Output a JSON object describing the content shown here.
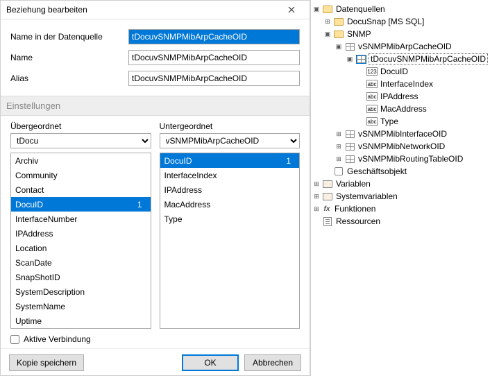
{
  "dialog": {
    "title": "Beziehung bearbeiten",
    "fields": {
      "datasourceLabel": "Name in der Datenquelle",
      "datasourceValue": "tDocuvSNMPMibArpCacheOID",
      "nameLabel": "Name",
      "nameValue": "tDocuvSNMPMibArpCacheOID",
      "aliasLabel": "Alias",
      "aliasValue": "tDocuvSNMPMibArpCacheOID"
    },
    "settingsHeader": "Einstellungen",
    "parent": {
      "label": "Übergeordnet",
      "selected": "tDocu",
      "items": [
        {
          "text": "Archiv"
        },
        {
          "text": "Community"
        },
        {
          "text": "Contact"
        },
        {
          "text": "DocuID",
          "num": "1",
          "selected": true
        },
        {
          "text": "InterfaceNumber"
        },
        {
          "text": "IPAddress"
        },
        {
          "text": "Location"
        },
        {
          "text": "ScanDate"
        },
        {
          "text": "SnapShotID"
        },
        {
          "text": "SystemDescription"
        },
        {
          "text": "SystemName"
        },
        {
          "text": "Uptime"
        }
      ]
    },
    "child": {
      "label": "Untergeordnet",
      "selected": "vSNMPMibArpCacheOID",
      "items": [
        {
          "text": "DocuID",
          "num": "1",
          "selected": true
        },
        {
          "text": "InterfaceIndex"
        },
        {
          "text": "IPAddress"
        },
        {
          "text": "MacAddress"
        },
        {
          "text": "Type"
        }
      ]
    },
    "activeLabel": "Aktive Verbindung",
    "activeChecked": false,
    "buttons": {
      "copy": "Kopie speichern",
      "ok": "OK",
      "cancel": "Abbrechen"
    }
  },
  "tree": {
    "root": "Datenquellen",
    "docusnap": "DocuSnap [MS SQL]",
    "snmp": "SNMP",
    "arp": "vSNMPMibArpCacheOID",
    "arpChild": "tDocuvSNMPMibArpCacheOID",
    "cols": {
      "docuid": "DocuID",
      "interfaceindex": "InterfaceIndex",
      "ip": "IPAddress",
      "mac": "MacAddress",
      "type": "Type"
    },
    "colTypes": {
      "docuid": "123",
      "interfaceindex": "abc",
      "ip": "abc",
      "mac": "abc",
      "type": "abc"
    },
    "iface": "vSNMPMibInterfaceOID",
    "net": "vSNMPMibNetworkOID",
    "route": "vSNMPMibRoutingTableOID",
    "geschaeft": "Geschäftsobjekt",
    "variablen": "Variablen",
    "sysvar": "Systemvariablen",
    "funkt": "Funktionen",
    "ress": "Ressourcen"
  }
}
